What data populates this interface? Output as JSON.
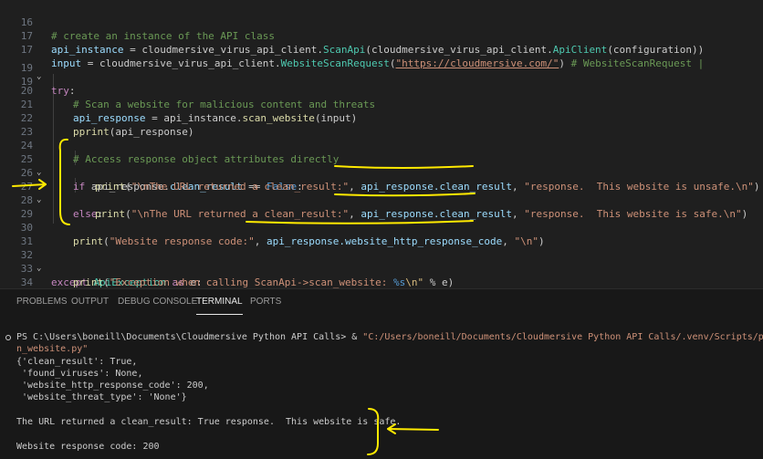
{
  "editor": {
    "lines": [
      {
        "num": "16",
        "tokens": [
          {
            "t": "# create an instance of the API class",
            "c": "c"
          }
        ]
      },
      {
        "num": "17a",
        "tokens": []
      },
      {
        "num": "18",
        "tokens": []
      }
    ],
    "l16": "16",
    "l16_code": "# create an instance of the API class",
    "l17": "17",
    "l17_a": "api_instance",
    "l17_b": " = cloudmersive_virus_api_client.",
    "l17_c": "ScanApi",
    "l17_d": "(cloudmersive_virus_api_client.",
    "l17_e": "ApiClient",
    "l17_f": "(configuration))",
    "l18": "17",
    "l18_a": "input",
    "l18_b": " = cloudmersive_virus_api_client.",
    "l18_c": "WebsiteScanRequest",
    "l18_d": "(",
    "l18_e": "\"https://cloudmersive.com/\"",
    "l18_f": ") ",
    "l18_g": "# WebsiteScanRequest |",
    "l19": "18",
    "l20": "19",
    "l20_a": "try",
    "l20_b": ":",
    "l21": "20",
    "l21_a": "# Scan a website for malicious content and threats",
    "l22": "21",
    "l22_a": "api_response",
    "l22_b": " = api_instance.",
    "l22_c": "scan_website",
    "l22_d": "(input)",
    "l23": "22",
    "l23_a": "pprint",
    "l23_b": "(api_response)",
    "l24": "23",
    "l25": "24",
    "l25_a": "# Access response object attributes directly",
    "l26": "25",
    "l26_a": "if",
    "l26_b": " api_response.",
    "l26_c": "clean_result",
    "l26_d": " == ",
    "l26_e": "False",
    "l26_f": ":",
    "l27": "26",
    "l27_a": "print",
    "l27_b": "(",
    "l27_c": "\"\\nThe URL returned a clean_result:\"",
    "l27_d": ", ",
    "l27_e": "api_response.clean_result",
    "l27_f": ", ",
    "l27_g": "\"response.  This website is unsafe.\\n\"",
    "l27_h": ")",
    "l28": "27",
    "l28_a": "else",
    "l28_b": ":",
    "l29": "28",
    "l29_a": "print",
    "l29_b": "(",
    "l29_c": "\"\\nThe URL returned a clean_result:\"",
    "l29_d": ", ",
    "l29_e": "api_response.clean_result",
    "l29_f": ", ",
    "l29_g": "\"response.  This website is safe.\\n\"",
    "l29_h": ")",
    "l30": "29",
    "l31": "30",
    "l31_a": "print",
    "l31_b": "(",
    "l31_c": "\"Website response code:\"",
    "l31_d": ", ",
    "l31_e": "api_response.website_http_response_code",
    "l31_f": ", ",
    "l31_g": "\"\\n\"",
    "l31_h": ")",
    "l32": "31",
    "l33": "32",
    "l33_a": "except",
    "l33_b": " ",
    "l33_c": "ApiException",
    "l33_d": " ",
    "l33_e": "as",
    "l33_f": " e:",
    "l34": "33",
    "l34_a": "print",
    "l34_b": "(",
    "l34_c": "\"Exception when calling ScanApi->scan_website: ",
    "l34_d": "%s",
    "l34_e": "\\n\"",
    "l34_f": " % e)",
    "l35": "34",
    "l36": "35"
  },
  "panel": {
    "tabs": [
      "PROBLEMS",
      "OUTPUT",
      "DEBUG CONSOLE",
      "TERMINAL",
      "PORTS"
    ],
    "active": "TERMINAL"
  },
  "terminal": {
    "prompt": "PS C:\\Users\\boneill\\Documents\\Cloudmersive Python API Calls> & ",
    "exe": "\"C:/Users/boneill/Documents/Cloudmersive Python API Calls/.venv/Scripts/python.exe\" \"c:",
    "cont": "n_website.py\"",
    "o1": "{'clean_result': True,",
    "o2": " 'found_viruses': None,",
    "o3": " 'website_http_response_code': 200,",
    "o4": " 'website_threat_type': 'None'}",
    "o5": "The URL returned a clean_result: True response.  This website is safe.",
    "o6": "Website response code: 200"
  },
  "colors": {
    "editor_bg": "#1f1f1f",
    "annotation": "#ffea00",
    "comment": "#6a9955",
    "keyword": "#c586c0",
    "string": "#ce9178",
    "function": "#dcdcaa"
  }
}
